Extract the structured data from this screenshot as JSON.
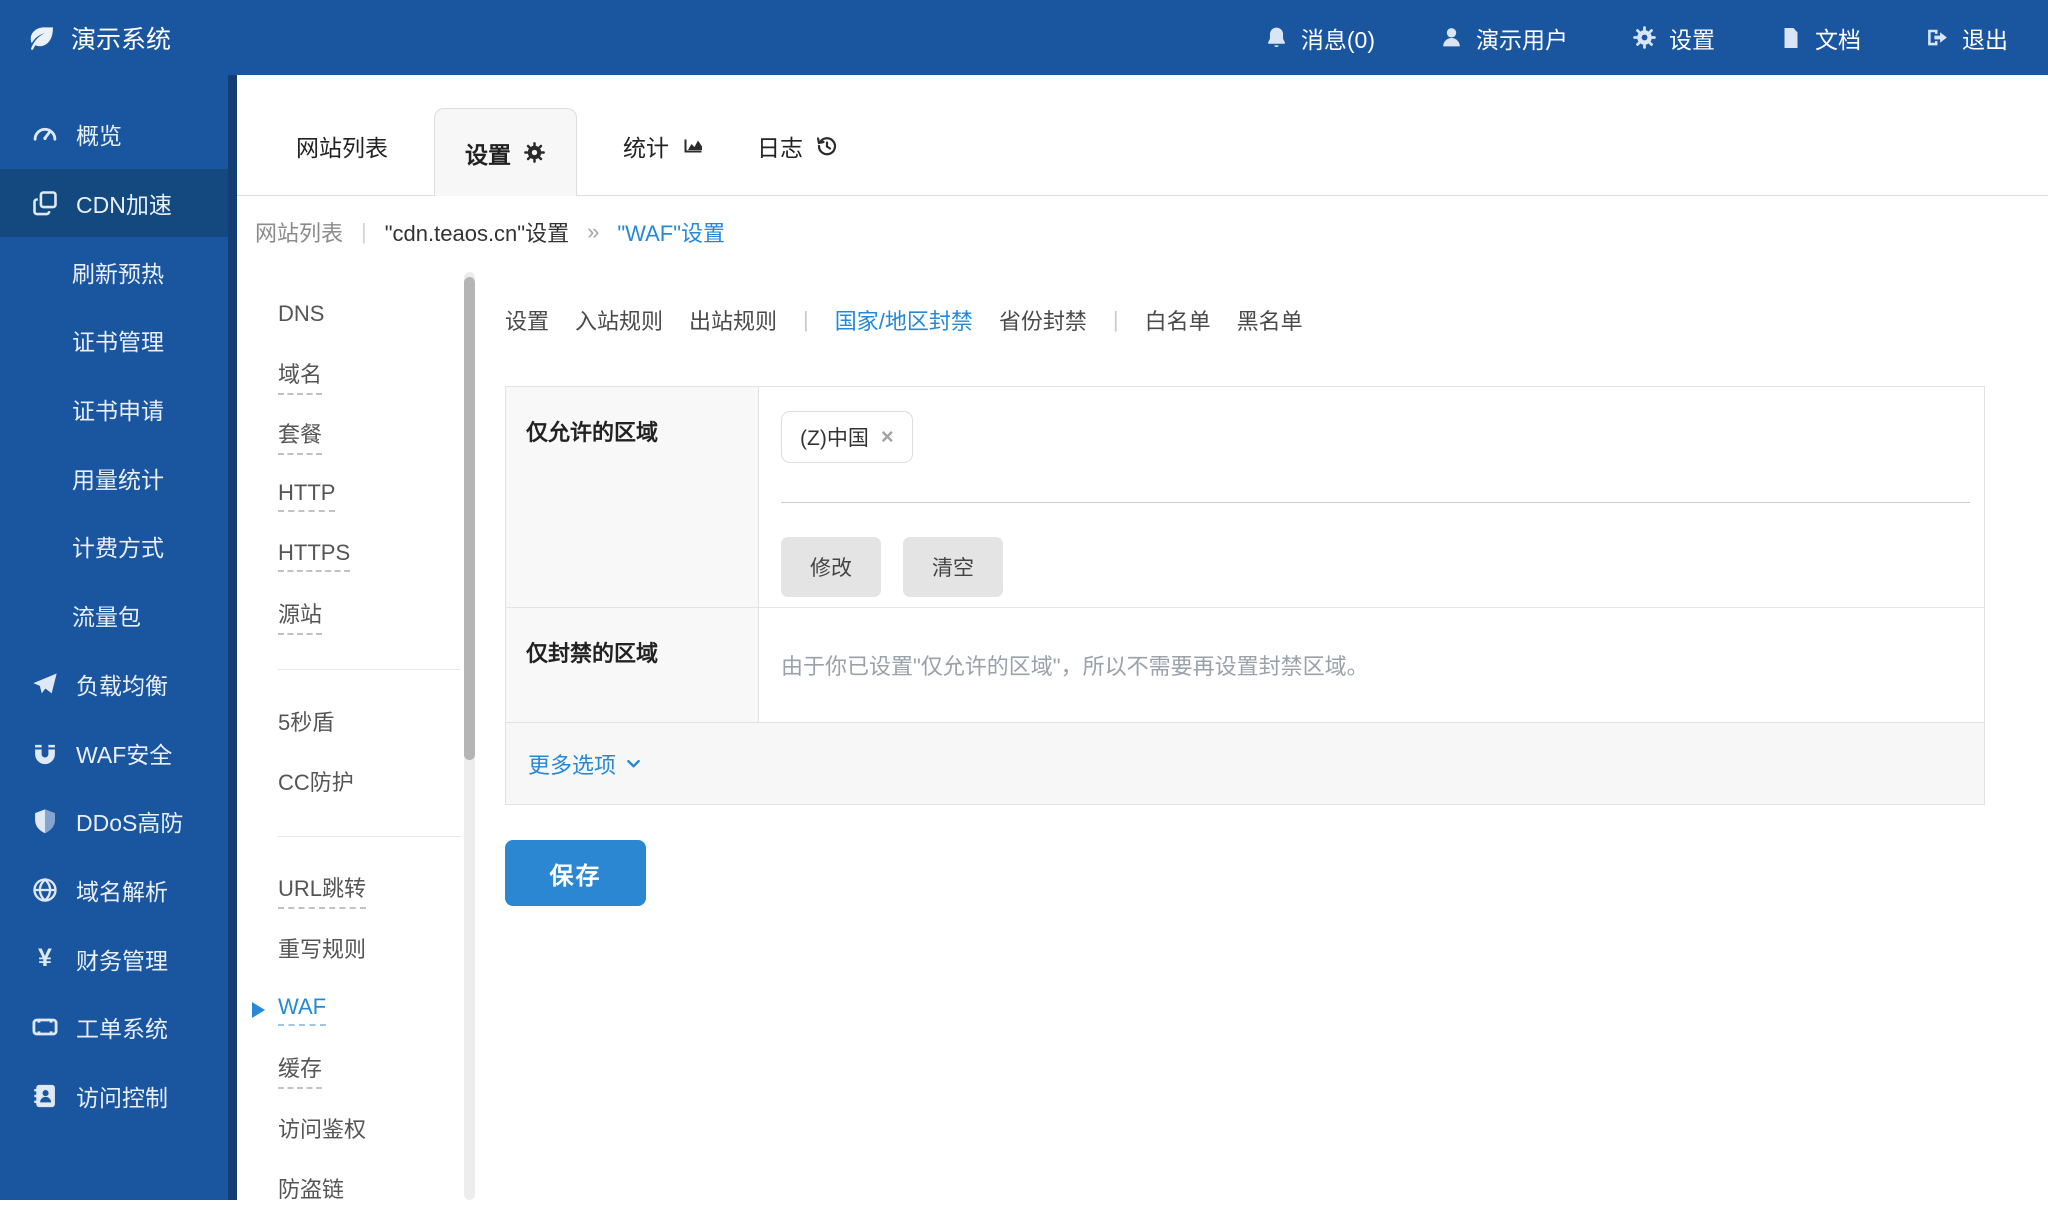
{
  "topbar": {
    "brand": "演示系统",
    "menu": [
      {
        "label": "消息(0)",
        "icon": "bell-icon"
      },
      {
        "label": "演示用户",
        "icon": "user-icon"
      },
      {
        "label": "设置",
        "icon": "gear-icon"
      },
      {
        "label": "文档",
        "icon": "doc-icon"
      },
      {
        "label": "退出",
        "icon": "logout-icon"
      }
    ]
  },
  "sidebar": {
    "items": [
      {
        "label": "概览",
        "icon": "dashboard-icon",
        "active": false
      },
      {
        "label": "CDN加速",
        "icon": "clone-icon",
        "active": true
      },
      {
        "label": "刷新预热",
        "sub": true
      },
      {
        "label": "证书管理",
        "sub": true
      },
      {
        "label": "证书申请",
        "sub": true
      },
      {
        "label": "用量统计",
        "sub": true
      },
      {
        "label": "计费方式",
        "sub": true
      },
      {
        "label": "流量包",
        "sub": true
      },
      {
        "label": "负载均衡",
        "icon": "paper-plane-icon"
      },
      {
        "label": "WAF安全",
        "icon": "magnet-icon"
      },
      {
        "label": "DDoS高防",
        "icon": "shield-half-icon"
      },
      {
        "label": "域名解析",
        "icon": "globe-icon"
      },
      {
        "label": "财务管理",
        "icon": "yen-icon"
      },
      {
        "label": "工单系统",
        "icon": "ticket-icon"
      },
      {
        "label": "访问控制",
        "icon": "address-book-icon"
      }
    ]
  },
  "tabs": {
    "items": [
      {
        "label": "网站列表",
        "active": false
      },
      {
        "label": "设置",
        "icon": "gear-icon",
        "active": true
      },
      {
        "label": "统计",
        "icon": "chart-area-icon",
        "active": false
      },
      {
        "label": "日志",
        "icon": "history-icon",
        "active": false
      }
    ]
  },
  "breadcrumb": {
    "root": "网站列表",
    "sep1": "|",
    "site": "\"cdn.teaos.cn\"设置",
    "sep2": "»",
    "current": "\"WAF\"设置"
  },
  "subsidebar": {
    "items": [
      {
        "label": "DNS",
        "dashed": false
      },
      {
        "label": "域名",
        "dashed": true
      },
      {
        "label": "套餐",
        "dashed": true
      },
      {
        "label": "HTTP",
        "dashed": true
      },
      {
        "label": "HTTPS",
        "dashed": true
      },
      {
        "label": "源站",
        "dashed": true
      },
      {
        "label": "5秒盾",
        "dashed": false
      },
      {
        "label": "CC防护",
        "dashed": false
      },
      {
        "label": "URL跳转",
        "dashed": true
      },
      {
        "label": "重写规则",
        "dashed": false
      },
      {
        "label": "WAF",
        "dashed": true,
        "active": true
      },
      {
        "label": "缓存",
        "dashed": true
      },
      {
        "label": "访问鉴权",
        "dashed": false
      },
      {
        "label": "防盗链",
        "dashed": false
      }
    ]
  },
  "waf_nav": {
    "items": [
      "设置",
      "入站规则",
      "出站规则",
      "国家/地区封禁",
      "省份封禁",
      "白名单",
      "黑名单"
    ],
    "active": "国家/地区封禁",
    "separator": "|"
  },
  "form": {
    "allowed_region": {
      "label": "仅允许的区域",
      "tag": "(Z)中国",
      "tag_close": "×",
      "modify_label": "修改",
      "clear_label": "清空"
    },
    "denied_region": {
      "label": "仅封禁的区域",
      "placeholder": "由于你已设置\"仅允许的区域\"，所以不需要再设置封禁区域。"
    },
    "more_options_label": "更多选项",
    "save_label": "保存"
  },
  "colors": {
    "topbar_bg": "#1a55a0",
    "sidebar_active_bg": "#14497f",
    "sidebar_edge": "#123e73",
    "accent_blue": "#2589d8",
    "save_button_bg": "#2b87d2",
    "label_cell_bg": "#f8f8f8"
  }
}
